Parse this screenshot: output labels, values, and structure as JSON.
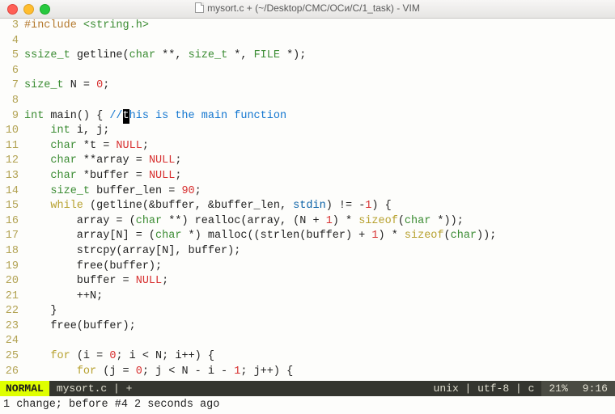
{
  "window": {
    "title": "mysort.c + (~/Desktop/CMC/ОСи/C/1_task) - VIM"
  },
  "lines": [
    {
      "n": "3",
      "html": "<span class='t-pre'>#include </span><span class='t-type'>&lt;string.h&gt;</span>"
    },
    {
      "n": "4",
      "html": ""
    },
    {
      "n": "5",
      "html": "<span class='t-type'>ssize_t</span> getline(<span class='t-type'>char</span> **, <span class='t-type'>size_t</span> *, <span class='t-type'>FILE</span> *);"
    },
    {
      "n": "6",
      "html": ""
    },
    {
      "n": "7",
      "html": "<span class='t-type'>size_t</span> N = <span class='t-num'>0</span>;"
    },
    {
      "n": "8",
      "html": ""
    },
    {
      "n": "9",
      "html": "<span class='t-type'>int</span> main() { <span class='t-cmt'>//<span class='cursor-block'>t</span>his is the main function</span>"
    },
    {
      "n": "10",
      "html": "    <span class='t-type'>int</span> i, j;"
    },
    {
      "n": "11",
      "html": "    <span class='t-type'>char</span> *t = <span class='t-null'>NULL</span>;"
    },
    {
      "n": "12",
      "html": "    <span class='t-type'>char</span> **array = <span class='t-null'>NULL</span>;"
    },
    {
      "n": "13",
      "html": "    <span class='t-type'>char</span> *buffer = <span class='t-null'>NULL</span>;"
    },
    {
      "n": "14",
      "html": "    <span class='t-type'>size_t</span> buffer_len = <span class='t-num'>90</span>;"
    },
    {
      "n": "15",
      "html": "    <span class='t-kw'>while</span> (getline(&buffer, &buffer_len, <span class='t-ident'>stdin</span>) != -<span class='t-num'>1</span>) {"
    },
    {
      "n": "16",
      "html": "        array = (<span class='t-type'>char</span> **) realloc(array, (N + <span class='t-num'>1</span>) * <span class='t-kw'>sizeof</span>(<span class='t-type'>char</span> *));"
    },
    {
      "n": "17",
      "html": "        array[N] = (<span class='t-type'>char</span> *) malloc((strlen(buffer) + <span class='t-num'>1</span>) * <span class='t-kw'>sizeof</span>(<span class='t-type'>char</span>));"
    },
    {
      "n": "18",
      "html": "        strcpy(array[N], buffer);"
    },
    {
      "n": "19",
      "html": "        free(buffer);"
    },
    {
      "n": "20",
      "html": "        buffer = <span class='t-null'>NULL</span>;"
    },
    {
      "n": "21",
      "html": "        ++N;"
    },
    {
      "n": "22",
      "html": "    }"
    },
    {
      "n": "23",
      "html": "    free(buffer);"
    },
    {
      "n": "24",
      "html": ""
    },
    {
      "n": "25",
      "html": "    <span class='t-kw'>for</span> (i = <span class='t-num'>0</span>; i &lt; N; i++) {"
    },
    {
      "n": "26",
      "html": "        <span class='t-kw'>for</span> (j = <span class='t-num'>0</span>; j &lt; N - i - <span class='t-num'>1</span>; j++) {"
    }
  ],
  "status": {
    "mode": "NORMAL",
    "file": "mysort.c | +",
    "info": "unix | utf-8 | c",
    "percent": "21%",
    "pos": "9:16"
  },
  "message": "1 change; before #4  2 seconds ago"
}
